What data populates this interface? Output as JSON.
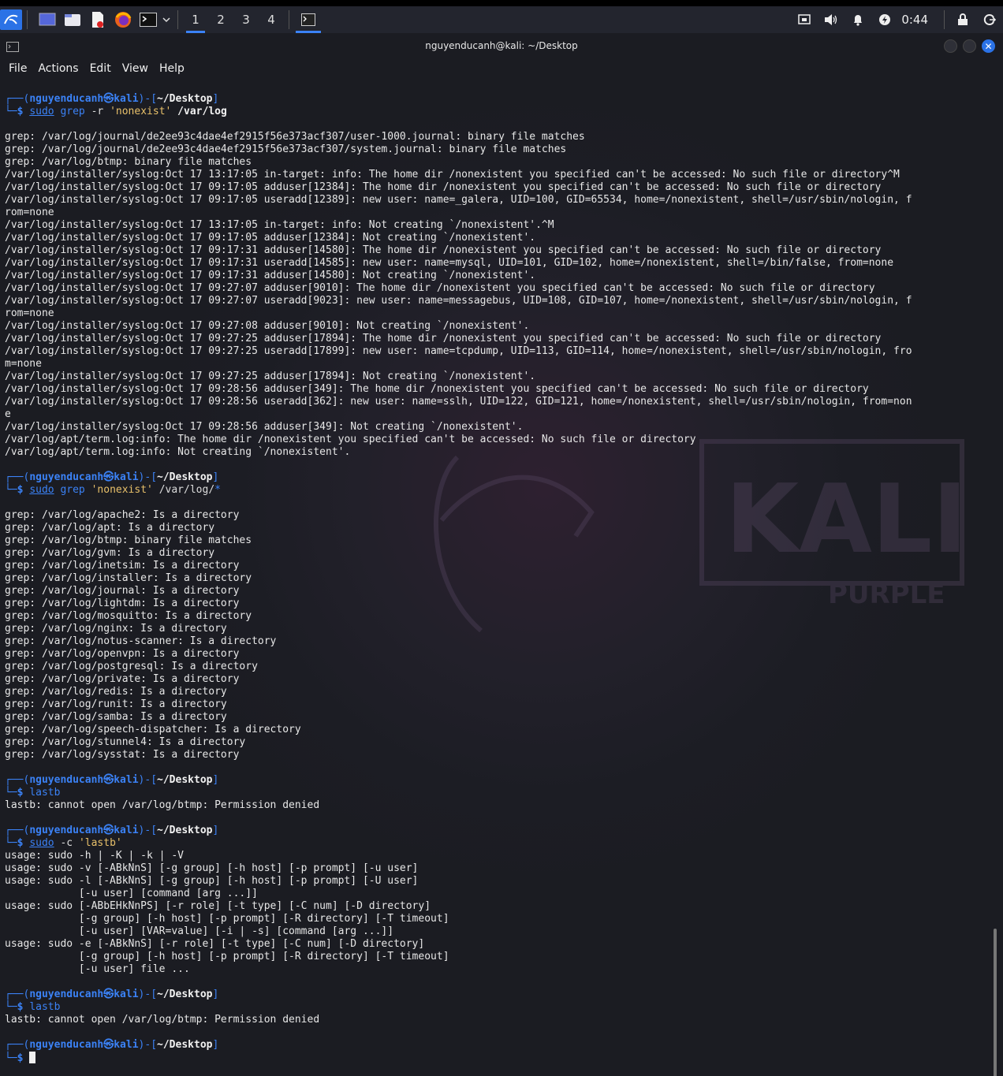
{
  "panel": {
    "workspaces": [
      "1",
      "2",
      "3",
      "4"
    ],
    "active_workspace": "1",
    "clock": "0:44",
    "icons": [
      "kali-menu-icon",
      "desktop-icon",
      "file-manager-icon",
      "text-editor-icon",
      "firefox-icon",
      "terminal-icon",
      "chevron-down-icon"
    ]
  },
  "window": {
    "title": "nguyenducanh@kali: ~/Desktop"
  },
  "menubar": [
    "File",
    "Actions",
    "Edit",
    "View",
    "Help"
  ],
  "prompt": {
    "user": "nguyenducanh",
    "sym": "㉿",
    "host": "kali",
    "dir": "~/Desktop"
  },
  "blocks": [
    {
      "cmd": "sudo",
      "args": [
        {
          "t": " -r ",
          "c": "opt"
        },
        {
          "t": "'nonexist'",
          "c": "str"
        },
        {
          "t": " /var/log",
          "c": "d"
        }
      ],
      "sub": "grep",
      "output": [
        "grep: /var/log/journal/de2ee93c4dae4ef2915f56e373acf307/user-1000.journal: binary file matches",
        "grep: /var/log/journal/de2ee93c4dae4ef2915f56e373acf307/system.journal: binary file matches",
        "grep: /var/log/btmp: binary file matches",
        "/var/log/installer/syslog:Oct 17 13:17:05 in-target: info: The home dir /nonexistent you specified can't be accessed: No such file or directory^M",
        "/var/log/installer/syslog:Oct 17 09:17:05 adduser[12384]: The home dir /nonexistent you specified can't be accessed: No such file or directory",
        "/var/log/installer/syslog:Oct 17 09:17:05 useradd[12389]: new user: name=_galera, UID=100, GID=65534, home=/nonexistent, shell=/usr/sbin/nologin, f",
        "rom=none",
        "/var/log/installer/syslog:Oct 17 13:17:05 in-target: info: Not creating `/nonexistent'.^M",
        "/var/log/installer/syslog:Oct 17 09:17:05 adduser[12384]: Not creating `/nonexistent'.",
        "/var/log/installer/syslog:Oct 17 09:17:31 adduser[14580]: The home dir /nonexistent you specified can't be accessed: No such file or directory",
        "/var/log/installer/syslog:Oct 17 09:17:31 useradd[14585]: new user: name=mysql, UID=101, GID=102, home=/nonexistent, shell=/bin/false, from=none",
        "/var/log/installer/syslog:Oct 17 09:17:31 adduser[14580]: Not creating `/nonexistent'.",
        "/var/log/installer/syslog:Oct 17 09:27:07 adduser[9010]: The home dir /nonexistent you specified can't be accessed: No such file or directory",
        "/var/log/installer/syslog:Oct 17 09:27:07 useradd[9023]: new user: name=messagebus, UID=108, GID=107, home=/nonexistent, shell=/usr/sbin/nologin, f",
        "rom=none",
        "/var/log/installer/syslog:Oct 17 09:27:08 adduser[9010]: Not creating `/nonexistent'.",
        "/var/log/installer/syslog:Oct 17 09:27:25 adduser[17894]: The home dir /nonexistent you specified can't be accessed: No such file or directory",
        "/var/log/installer/syslog:Oct 17 09:27:25 useradd[17899]: new user: name=tcpdump, UID=113, GID=114, home=/nonexistent, shell=/usr/sbin/nologin, fro",
        "m=none",
        "/var/log/installer/syslog:Oct 17 09:27:25 adduser[17894]: Not creating `/nonexistent'.",
        "/var/log/installer/syslog:Oct 17 09:28:56 adduser[349]: The home dir /nonexistent you specified can't be accessed: No such file or directory",
        "/var/log/installer/syslog:Oct 17 09:28:56 useradd[362]: new user: name=sslh, UID=122, GID=121, home=/nonexistent, shell=/usr/sbin/nologin, from=non",
        "e",
        "/var/log/installer/syslog:Oct 17 09:28:56 adduser[349]: Not creating `/nonexistent'.",
        "/var/log/apt/term.log:info: The home dir /nonexistent you specified can't be accessed: No such file or directory",
        "/var/log/apt/term.log:info: Not creating `/nonexistent'."
      ]
    },
    {
      "cmd": "sudo",
      "sub": "grep",
      "args": [
        {
          "t": " ",
          "c": "opt"
        },
        {
          "t": "'nonexist'",
          "c": "str"
        },
        {
          "t": " /var/log/",
          "c": "opt"
        },
        {
          "t": "*",
          "c": "glob"
        }
      ],
      "output": [
        "grep: /var/log/apache2: Is a directory",
        "grep: /var/log/apt: Is a directory",
        "grep: /var/log/btmp: binary file matches",
        "grep: /var/log/gvm: Is a directory",
        "grep: /var/log/inetsim: Is a directory",
        "grep: /var/log/installer: Is a directory",
        "grep: /var/log/journal: Is a directory",
        "grep: /var/log/lightdm: Is a directory",
        "grep: /var/log/mosquitto: Is a directory",
        "grep: /var/log/nginx: Is a directory",
        "grep: /var/log/notus-scanner: Is a directory",
        "grep: /var/log/openvpn: Is a directory",
        "grep: /var/log/postgresql: Is a directory",
        "grep: /var/log/private: Is a directory",
        "grep: /var/log/redis: Is a directory",
        "grep: /var/log/runit: Is a directory",
        "grep: /var/log/samba: Is a directory",
        "grep: /var/log/speech-dispatcher: Is a directory",
        "grep: /var/log/stunnel4: Is a directory",
        "grep: /var/log/sysstat: Is a directory"
      ]
    },
    {
      "cmd": "lastb",
      "sub": "",
      "args": [],
      "output": [
        "lastb: cannot open /var/log/btmp: Permission denied"
      ]
    },
    {
      "cmd": "sudo",
      "sub": "",
      "args": [
        {
          "t": " -c ",
          "c": "opt"
        },
        {
          "t": "'lastb'",
          "c": "str"
        }
      ],
      "output": [
        "usage: sudo -h | -K | -k | -V",
        "usage: sudo -v [-ABkNnS] [-g group] [-h host] [-p prompt] [-u user]",
        "usage: sudo -l [-ABkNnS] [-g group] [-h host] [-p prompt] [-U user]",
        "            [-u user] [command [arg ...]]",
        "usage: sudo [-ABbEHkNnPS] [-r role] [-t type] [-C num] [-D directory]",
        "            [-g group] [-h host] [-p prompt] [-R directory] [-T timeout]",
        "            [-u user] [VAR=value] [-i | -s] [command [arg ...]]",
        "usage: sudo -e [-ABkNnS] [-r role] [-t type] [-C num] [-D directory]",
        "            [-g group] [-h host] [-p prompt] [-R directory] [-T timeout]",
        "            [-u user] file ..."
      ]
    },
    {
      "cmd": "lastb",
      "sub": "",
      "args": [],
      "output": [
        "lastb: cannot open /var/log/btmp: Permission denied"
      ]
    }
  ],
  "wallpaper_text": {
    "brand": "KALI",
    "edition": "PURPLE"
  },
  "colors": {
    "accent": "#3b82f6",
    "string": "#e8c06a",
    "background": "#1b1c22"
  }
}
